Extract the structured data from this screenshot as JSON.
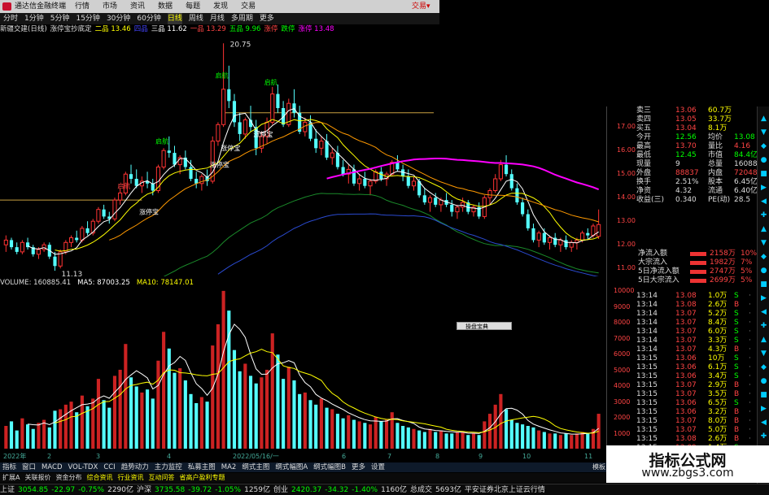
{
  "titlebar": {
    "title": "通达信金融终端",
    "menu": [
      "行情",
      "市场",
      "资讯",
      "数据",
      "每题",
      "发现",
      "交易"
    ],
    "trade": "交易▾"
  },
  "periods": [
    {
      "label": "分时",
      "on": false
    },
    {
      "label": "1分钟",
      "on": false
    },
    {
      "label": "5分钟",
      "on": false
    },
    {
      "label": "15分钟",
      "on": false
    },
    {
      "label": "30分钟",
      "on": false
    },
    {
      "label": "60分钟",
      "on": false
    },
    {
      "label": "日线",
      "on": true
    },
    {
      "label": "周线",
      "on": false
    },
    {
      "label": "月线",
      "on": false
    },
    {
      "label": "多周期",
      "on": false
    },
    {
      "label": "更多",
      "on": false
    }
  ],
  "info": [
    {
      "t": "新疆交建(日线)",
      "c": "#ddd"
    },
    {
      "t": "涨停宝抄底定",
      "c": "#ddd"
    },
    {
      "t": "二品 13.46",
      "c": "#ff0"
    },
    {
      "t": "四品",
      "c": "#44f"
    },
    {
      "t": "三品 11.62",
      "c": "#fff"
    },
    {
      "t": "一品 13.29",
      "c": "#f44"
    },
    {
      "t": "五品 9.96",
      "c": "#0f0"
    },
    {
      "t": "涨停",
      "c": "#f44"
    },
    {
      "t": "跌停",
      "c": "#0f0"
    },
    {
      "t": "涨停 13.48",
      "c": "#f0f"
    }
  ],
  "chart_labels": {
    "high": "20.75",
    "low": "11.13",
    "tags": [
      "启航",
      "启航",
      "启航",
      "启航",
      "涨停宝",
      "涨停宝",
      "涨停宝",
      "涨停宝"
    ]
  },
  "price_axis": [
    "17.00",
    "16.00",
    "15.00",
    "14.00",
    "13.00",
    "12.00",
    "11.00"
  ],
  "vol_header": [
    {
      "t": "VOLUME: 160885.41",
      "c": "#ddd"
    },
    {
      "t": "MA5: 87003.25",
      "c": "#fff"
    },
    {
      "t": "MA10: 78147.01",
      "c": "#ff0"
    }
  ],
  "vol_axis": [
    "10000",
    "9000",
    "8000",
    "7000",
    "6000",
    "5000",
    "4000",
    "3000",
    "2000",
    "1000"
  ],
  "date_axis": [
    {
      "t": "2022年",
      "x": 4
    },
    {
      "t": "2",
      "x": 58
    },
    {
      "t": "3",
      "x": 118
    },
    {
      "t": "4",
      "x": 205
    },
    {
      "t": "2022/05/16/一",
      "x": 286
    },
    {
      "t": "6",
      "x": 420
    },
    {
      "t": "7",
      "x": 476
    },
    {
      "t": "8",
      "x": 535
    },
    {
      "t": "9",
      "x": 588
    },
    {
      "t": "10",
      "x": 642
    },
    {
      "t": "11",
      "x": 718
    }
  ],
  "tabs": [
    "指标",
    "窗口",
    "MACD",
    "VOL-TDX",
    "CCI",
    "趋势动力",
    "主力监控",
    "私募主图",
    "MA2",
    "纲式主图",
    "纲式幅图A",
    "纲式幅图B",
    "更多",
    "设置"
  ],
  "tabs_highlight": [],
  "mode": "模板",
  "popup": "操盘宝典",
  "quote": [
    {
      "l": "卖三",
      "v": "13.06",
      "v2": "60.7万",
      "c": "#f44"
    },
    {
      "l": "卖四",
      "v": "13.05",
      "v2": "33.7万",
      "c": "#f44"
    },
    {
      "l": "买五",
      "v": "13.04",
      "v2": "8.1万",
      "c": "#f44"
    },
    {
      "l": "今开",
      "v": "12.56",
      "v2": "均价",
      "v3": "13.08",
      "c": "#0f0"
    },
    {
      "l": "最高",
      "v": "13.70",
      "v2": "量比",
      "v3": "4.16",
      "c": "#f44"
    },
    {
      "l": "最低",
      "v": "12.45",
      "v2": "市值",
      "v3": "84.4亿",
      "c": "#0f0"
    },
    {
      "l": "现量",
      "v": "9",
      "v2": "总量",
      "v3": "160885",
      "c": "#ddd"
    },
    {
      "l": "外盘",
      "v": "88837",
      "v2": "内盘",
      "v3": "72048",
      "c": "#f44"
    },
    {
      "l": "换手",
      "v": "2.51%",
      "v2": "股本",
      "v3": "6.45亿",
      "c": "#ddd"
    },
    {
      "l": "净资",
      "v": "4.32",
      "v2": "流通",
      "v3": "6.40亿",
      "c": "#ddd"
    },
    {
      "l": "收益(三)",
      "v": "0.340",
      "v2": "PE(动)",
      "v3": "28.5",
      "c": "#ddd"
    }
  ],
  "flows": [
    {
      "l": "净流入额",
      "v": "2158万",
      "p": "10%"
    },
    {
      "l": "大宗流入",
      "v": "1982万",
      "p": "7%"
    },
    {
      "l": "5日净流入额",
      "v": "2747万",
      "p": "5%"
    },
    {
      "l": "5日大宗流入",
      "v": "2699万",
      "p": "5%"
    }
  ],
  "ticks": [
    {
      "t": "13:14",
      "p": "13.08",
      "v": "1.0万",
      "s": "S"
    },
    {
      "t": "13:14",
      "p": "13.08",
      "v": "2.6万",
      "s": "B"
    },
    {
      "t": "13:14",
      "p": "13.07",
      "v": "5.2万",
      "s": "S"
    },
    {
      "t": "13:14",
      "p": "13.07",
      "v": "8.4万",
      "s": "S"
    },
    {
      "t": "13:14",
      "p": "13.07",
      "v": "6.0万",
      "s": "S"
    },
    {
      "t": "13:14",
      "p": "13.07",
      "v": "3.3万",
      "s": "S"
    },
    {
      "t": "13:14",
      "p": "13.07",
      "v": "4.3万",
      "s": "B"
    },
    {
      "t": "13:15",
      "p": "13.06",
      "v": "10万",
      "s": "S"
    },
    {
      "t": "13:15",
      "p": "13.06",
      "v": "6.1万",
      "s": "S"
    },
    {
      "t": "13:15",
      "p": "13.06",
      "v": "3.4万",
      "s": "S"
    },
    {
      "t": "13:15",
      "p": "13.07",
      "v": "2.9万",
      "s": "B"
    },
    {
      "t": "13:15",
      "p": "13.07",
      "v": "3.5万",
      "s": "B"
    },
    {
      "t": "13:15",
      "p": "13.06",
      "v": "6.5万",
      "s": "S"
    },
    {
      "t": "13:15",
      "p": "13.06",
      "v": "3.2万",
      "s": "B"
    },
    {
      "t": "13:15",
      "p": "13.07",
      "v": "8.0万",
      "s": "B"
    },
    {
      "t": "13:15",
      "p": "13.07",
      "v": "5.0万",
      "s": "B"
    },
    {
      "t": "13:15",
      "p": "13.08",
      "v": "2.6万",
      "s": "B"
    },
    {
      "t": "13:15",
      "p": "13.09",
      "v": "1.4万",
      "s": "S"
    },
    {
      "t": "13:15",
      "p": "13.09",
      "v": "1.1万",
      "s": "S"
    },
    {
      "t": "13:15",
      "p": "13.08",
      "v": "1.2万",
      "s": "S"
    }
  ],
  "status": [
    {
      "t": "上证",
      "c": "#ddd"
    },
    {
      "t": "3054.85",
      "c": "#0f0"
    },
    {
      "t": "-22.97",
      "c": "#0f0"
    },
    {
      "t": "-0.75%",
      "c": "#0f0"
    },
    {
      "t": "2290亿",
      "c": "#ddd"
    },
    {
      "t": "沪深",
      "c": "#ddd"
    },
    {
      "t": "3735.58",
      "c": "#0f0"
    },
    {
      "t": "-39.72",
      "c": "#0f0"
    },
    {
      "t": "-1.05%",
      "c": "#0f0"
    },
    {
      "t": "1259亿",
      "c": "#ddd"
    },
    {
      "t": "创业",
      "c": "#ddd"
    },
    {
      "t": "2420.37",
      "c": "#0f0"
    },
    {
      "t": "-34.32",
      "c": "#0f0"
    },
    {
      "t": "-1.40%",
      "c": "#0f0"
    },
    {
      "t": "1160亿",
      "c": "#ddd"
    },
    {
      "t": "总成交",
      "c": "#ddd"
    },
    {
      "t": "5693亿",
      "c": "#ddd"
    },
    {
      "t": "平安证券北京上证云行情",
      "c": "#ddd"
    }
  ],
  "bottom_strip": [
    "扩展A",
    "关联报价",
    "资金分布",
    "综合资讯",
    "行业资讯",
    "互动问答",
    "省高户盈利专题"
  ],
  "watermark": {
    "title": "指标公式网",
    "url": "www.zbgs3.com"
  },
  "colors": {
    "up": "#ff3333",
    "down": "#54ffff",
    "ma5": "#ffffff",
    "ma10": "#ffff00",
    "ma20": "#ff9900",
    "ma60": "#ff00ff"
  },
  "chart_data": {
    "type": "candlestick",
    "ylim": [
      11,
      21
    ],
    "ohlc": [
      [
        12.2,
        12.6,
        11.9,
        12.4
      ],
      [
        12.4,
        12.5,
        12.0,
        12.1
      ],
      [
        12.1,
        12.3,
        11.8,
        11.9
      ],
      [
        11.9,
        12.4,
        11.8,
        12.3
      ],
      [
        12.3,
        12.5,
        12.0,
        12.1
      ],
      [
        12.1,
        12.2,
        11.7,
        11.8
      ],
      [
        11.8,
        12.1,
        11.6,
        12.0
      ],
      [
        12.0,
        12.3,
        11.9,
        12.2
      ],
      [
        12.2,
        12.3,
        11.6,
        11.7
      ],
      [
        11.7,
        11.9,
        11.1,
        11.3
      ],
      [
        11.3,
        12.0,
        11.2,
        11.9
      ],
      [
        11.9,
        12.4,
        11.8,
        12.3
      ],
      [
        12.3,
        12.6,
        12.1,
        12.5
      ],
      [
        12.5,
        12.8,
        12.3,
        12.4
      ],
      [
        12.4,
        13.0,
        12.3,
        12.9
      ],
      [
        12.9,
        13.2,
        12.6,
        12.7
      ],
      [
        12.7,
        13.3,
        12.6,
        13.2
      ],
      [
        13.2,
        13.8,
        13.1,
        13.7
      ],
      [
        13.7,
        13.9,
        13.3,
        13.4
      ],
      [
        13.4,
        13.6,
        13.1,
        13.3
      ],
      [
        13.3,
        14.2,
        13.2,
        14.1
      ],
      [
        14.1,
        14.6,
        13.9,
        14.4
      ],
      [
        14.4,
        15.3,
        14.3,
        15.2
      ],
      [
        15.2,
        15.6,
        14.8,
        15.0
      ],
      [
        15.0,
        15.4,
        14.6,
        14.7
      ],
      [
        14.7,
        15.1,
        14.4,
        14.9
      ],
      [
        14.9,
        15.3,
        14.6,
        14.8
      ],
      [
        14.8,
        15.0,
        14.3,
        14.5
      ],
      [
        14.5,
        15.6,
        14.4,
        15.5
      ],
      [
        15.5,
        16.3,
        15.4,
        16.2
      ],
      [
        16.2,
        16.8,
        15.9,
        16.1
      ],
      [
        16.1,
        16.4,
        15.5,
        15.6
      ],
      [
        15.6,
        16.0,
        15.2,
        15.9
      ],
      [
        15.9,
        16.2,
        15.4,
        15.5
      ],
      [
        15.5,
        15.8,
        14.9,
        15.0
      ],
      [
        15.0,
        15.3,
        14.6,
        14.8
      ],
      [
        14.8,
        15.2,
        14.5,
        15.1
      ],
      [
        15.1,
        15.4,
        14.7,
        14.9
      ],
      [
        14.9,
        16.8,
        14.8,
        16.6
      ],
      [
        16.6,
        17.4,
        16.4,
        17.3
      ],
      [
        17.3,
        20.75,
        17.2,
        18.8
      ],
      [
        18.8,
        19.8,
        18.0,
        18.3
      ],
      [
        18.3,
        18.6,
        17.2,
        17.4
      ],
      [
        17.4,
        17.8,
        16.6,
        16.9
      ],
      [
        16.9,
        17.6,
        16.7,
        17.5
      ],
      [
        17.5,
        18.1,
        17.0,
        17.2
      ],
      [
        17.2,
        17.5,
        16.0,
        16.3
      ],
      [
        16.3,
        17.0,
        16.1,
        16.8
      ],
      [
        16.8,
        17.6,
        16.5,
        17.4
      ],
      [
        17.4,
        18.9,
        17.3,
        18.6
      ],
      [
        18.6,
        19.0,
        17.8,
        18.0
      ],
      [
        18.0,
        18.3,
        17.2,
        17.3
      ],
      [
        17.3,
        18.4,
        17.2,
        18.2
      ],
      [
        18.2,
        18.8,
        17.6,
        17.8
      ],
      [
        17.8,
        18.1,
        16.9,
        17.0
      ],
      [
        17.0,
        17.6,
        16.8,
        17.4
      ],
      [
        17.4,
        17.7,
        16.6,
        16.7
      ],
      [
        16.7,
        17.1,
        16.1,
        16.3
      ],
      [
        16.3,
        16.8,
        16.0,
        16.6
      ],
      [
        16.6,
        16.9,
        15.8,
        15.9
      ],
      [
        15.9,
        16.3,
        15.6,
        16.1
      ],
      [
        16.1,
        16.4,
        15.4,
        15.5
      ],
      [
        15.5,
        15.8,
        15.1,
        15.2
      ],
      [
        15.2,
        15.6,
        14.8,
        15.4
      ],
      [
        15.4,
        15.6,
        14.7,
        14.8
      ],
      [
        14.8,
        15.2,
        14.5,
        15.0
      ],
      [
        15.0,
        15.3,
        14.6,
        14.7
      ],
      [
        14.7,
        15.0,
        14.3,
        14.9
      ],
      [
        14.9,
        15.4,
        14.8,
        15.3
      ],
      [
        15.3,
        15.5,
        14.9,
        15.0
      ],
      [
        15.0,
        15.3,
        14.7,
        15.2
      ],
      [
        15.2,
        15.8,
        15.1,
        15.7
      ],
      [
        15.7,
        16.0,
        15.3,
        15.4
      ],
      [
        15.4,
        15.6,
        14.9,
        15.1
      ],
      [
        15.1,
        15.4,
        14.6,
        14.7
      ],
      [
        14.7,
        15.1,
        14.5,
        14.9
      ],
      [
        14.9,
        15.0,
        14.2,
        14.3
      ],
      [
        14.3,
        14.6,
        13.9,
        14.0
      ],
      [
        14.0,
        14.3,
        13.6,
        14.2
      ],
      [
        14.2,
        14.4,
        13.8,
        13.9
      ],
      [
        13.9,
        14.2,
        13.6,
        14.1
      ],
      [
        14.1,
        14.4,
        13.8,
        13.9
      ],
      [
        13.9,
        14.1,
        13.4,
        13.6
      ],
      [
        13.6,
        13.9,
        13.3,
        13.8
      ],
      [
        13.8,
        14.2,
        13.6,
        14.0
      ],
      [
        14.0,
        14.1,
        13.5,
        13.6
      ],
      [
        13.6,
        13.9,
        13.4,
        13.8
      ],
      [
        13.8,
        14.0,
        13.3,
        13.4
      ],
      [
        13.4,
        14.3,
        13.3,
        14.2
      ],
      [
        14.2,
        14.6,
        13.9,
        14.5
      ],
      [
        14.5,
        15.2,
        14.4,
        15.0
      ],
      [
        15.0,
        15.8,
        14.9,
        15.6
      ],
      [
        15.6,
        16.0,
        15.1,
        15.2
      ],
      [
        15.2,
        15.4,
        14.5,
        14.6
      ],
      [
        14.6,
        14.8,
        13.9,
        14.0
      ],
      [
        14.0,
        14.2,
        13.4,
        13.5
      ],
      [
        13.5,
        13.7,
        12.8,
        12.9
      ],
      [
        12.9,
        13.1,
        12.3,
        12.4
      ],
      [
        12.4,
        12.8,
        12.1,
        12.7
      ],
      [
        12.7,
        12.9,
        12.2,
        12.3
      ],
      [
        12.3,
        12.6,
        12.0,
        12.5
      ],
      [
        12.5,
        12.7,
        12.1,
        12.2
      ],
      [
        12.2,
        12.5,
        11.9,
        12.4
      ],
      [
        12.4,
        12.6,
        12.0,
        12.1
      ],
      [
        12.1,
        12.4,
        11.9,
        12.3
      ],
      [
        12.3,
        12.5,
        12.0,
        12.4
      ],
      [
        12.4,
        12.8,
        12.3,
        12.7
      ],
      [
        12.7,
        12.9,
        12.4,
        12.6
      ],
      [
        12.6,
        13.1,
        12.5,
        13.0
      ],
      [
        12.56,
        13.7,
        12.45,
        13.06
      ]
    ],
    "volume": [
      1500,
      1800,
      1200,
      2000,
      1600,
      1300,
      1700,
      1900,
      1400,
      2500,
      2600,
      2900,
      3100,
      2400,
      3500,
      2800,
      3300,
      4600,
      3200,
      2700,
      4800,
      5200,
      6900,
      4700,
      4100,
      3700,
      3900,
      3300,
      5800,
      7700,
      6600,
      5000,
      5300,
      4500,
      3600,
      3000,
      3400,
      3100,
      6800,
      8200,
      10400,
      9100,
      6500,
      5100,
      5600,
      4800,
      4300,
      4700,
      5200,
      7600,
      6200,
      4600,
      5400,
      4500,
      3600,
      3700,
      3200,
      2900,
      3300,
      2700,
      2600,
      2300,
      2000,
      2200,
      1900,
      1800,
      1700,
      1600,
      2100,
      1800,
      1900,
      2400,
      1700,
      1500,
      1400,
      1300,
      1200,
      1100,
      1300,
      1100,
      1200,
      1000,
      1000,
      1100,
      1100,
      900,
      1000,
      900,
      1800,
      2300,
      2900,
      3600,
      2600,
      1900,
      1700,
      1600,
      1500,
      1400,
      1200,
      1100,
      1000,
      1000,
      900,
      1000,
      900,
      1000,
      1100,
      1000,
      1300,
      2300
    ]
  }
}
